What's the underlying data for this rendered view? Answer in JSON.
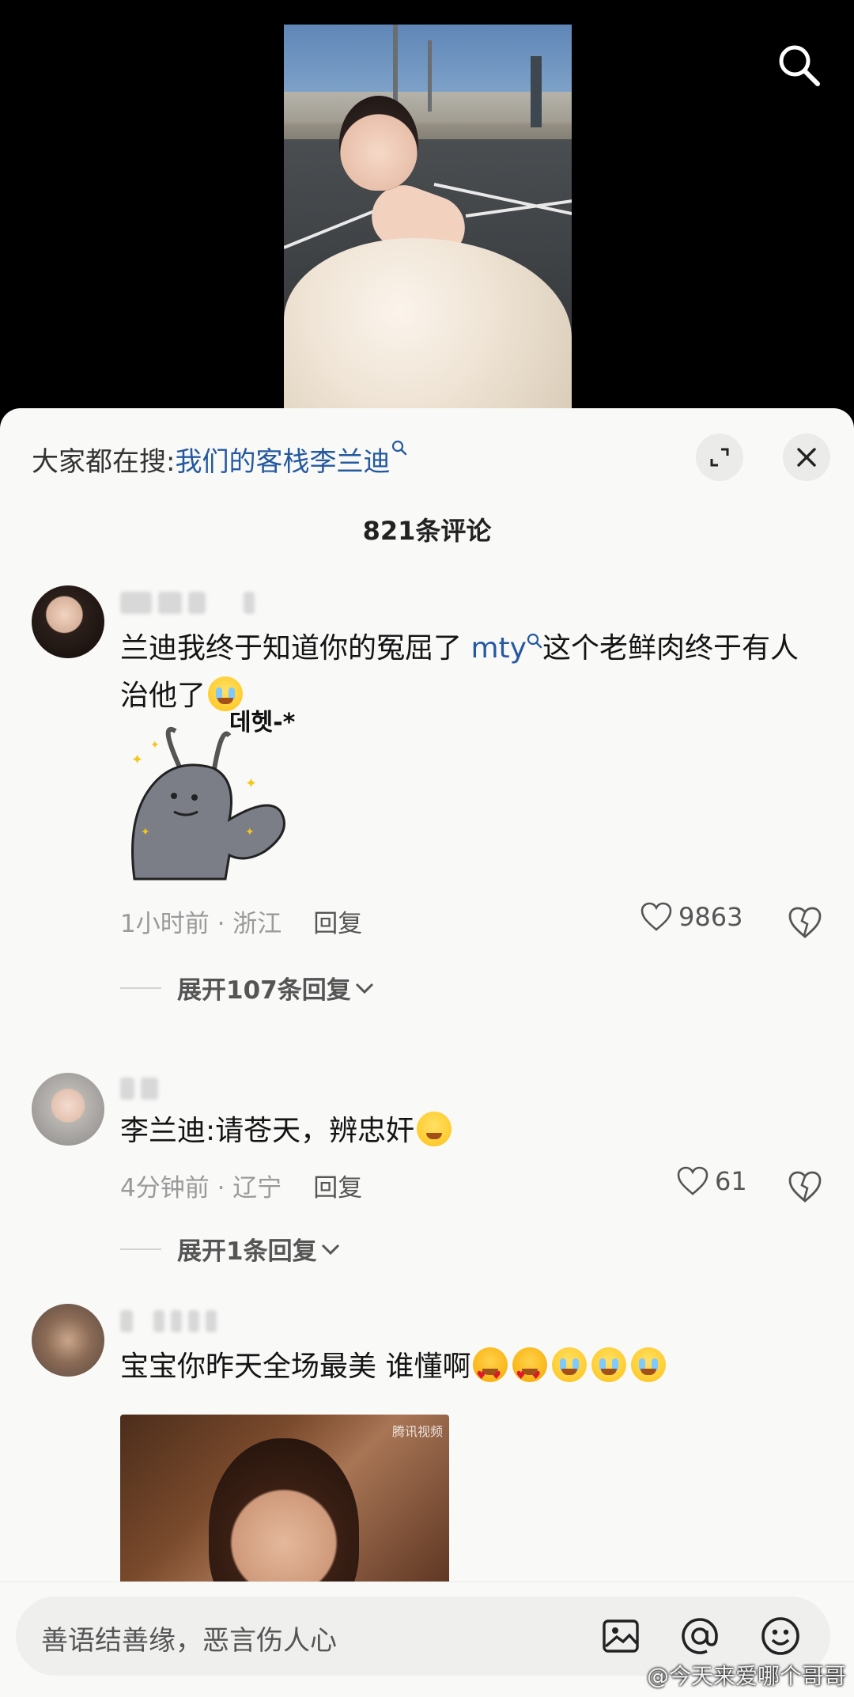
{
  "video": {
    "search_icon": "search-icon"
  },
  "panel": {
    "hot_search_prefix": "大家都在搜:",
    "hot_search_keyword": "我们的客栈李兰迪",
    "expand_icon": "expand-icon",
    "close_icon": "close-icon",
    "comment_count": "821条评论"
  },
  "comments": [
    {
      "text_a": "兰迪我终于知道你的冤屈了 ",
      "link": "mty",
      "text_b": "这个老鲜肉终于有人治他了",
      "sticker_caption": "데헷-*",
      "time_location": "1小时前 · 浙江",
      "reply_label": "回复",
      "likes": "9863",
      "expand_label": "展开107条回复"
    },
    {
      "text_a": "李兰迪:请苍天，辨忠奸",
      "time_location": "4分钟前 · 辽宁",
      "reply_label": "回复",
      "likes": "61",
      "expand_label": "展开1条回复"
    },
    {
      "text_a": "宝宝你昨天全场最美 谁懂啊",
      "gif_watermark": "腾讯视频"
    }
  ],
  "input": {
    "placeholder": "善语结善缘，恶言伤人心",
    "image_icon": "image-icon",
    "at_icon": "at-icon",
    "emoji_icon": "emoji-icon"
  },
  "watermark": "@今天来爱哪个哥哥",
  "colors": {
    "link": "#25599f",
    "background": "#f9f9f8",
    "meta_text": "#9a9a9a"
  }
}
